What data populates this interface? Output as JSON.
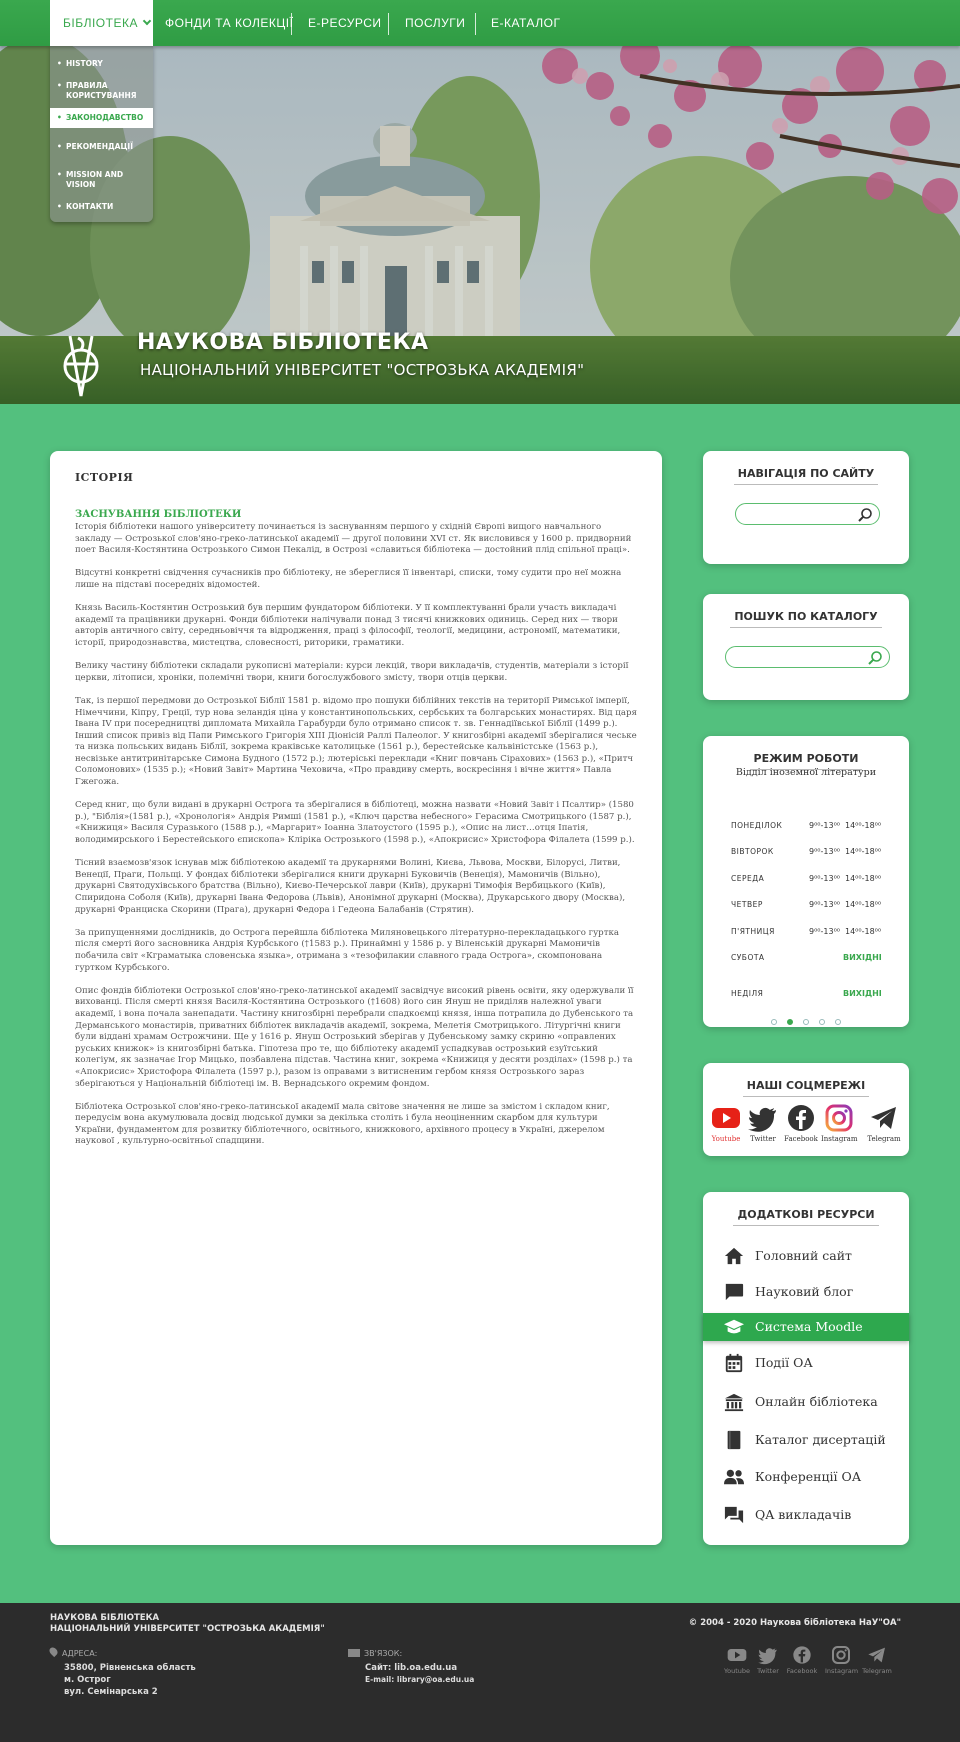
{
  "nav": {
    "items": [
      "Бібліотека",
      "Фонди та колекції",
      "Е-ресурси",
      "Послуги",
      "Е-каталог"
    ],
    "dropdown": [
      "History",
      "Правила користування",
      "Законодавство",
      "Рекомендації",
      "Mission and vision",
      "Контакти"
    ]
  },
  "hero": {
    "title": "НАУКОВА БІБЛІОТЕКА",
    "subtitle": "НАЦІОНАЛЬНИЙ УНІВЕРСИТЕТ \"ОСТРОЗЬКА АКАДЕМІЯ\""
  },
  "article": {
    "title": "ІСТОРІЯ",
    "section": "ЗАСНУВАННЯ БІБЛІОТЕКИ",
    "paragraphs": [
      "Історія бібліотеки нашого університету починається із заснуванням першого у східній Європі вищого навчального закладу — Острозької слов'яно-греко-латинської академії — другої половини XVI ст. Як висловився у 1600 р. придворний поет Василя-Костянтина Острозького Симон Пекалід, в Острозі «славиться бібліотека — достойний плід спільної праці».",
      "Відсутні конкретні свідчення сучасників про бібліотеку, не збереглися її інвентарі, списки, тому судити про неї можна лише на підставі посередніх відомостей.",
      "Князь Василь-Костянтин Острозький був першим фундатором бібліотеки. У її комплектуванні брали участь викладачі академії та працівники друкарні. Фонди бібліотеки налічували понад 3 тисячі книжкових одиниць. Серед них — твори авторів античного світу, середньовіччя та відродження, праці з філософії, теології, медицини, астрономії, математики, історії, природознавства, мистецтва, словесності, риторики, граматики.",
      "Велику частину бібліотеки складали рукописні матеріали: курси лекцій, твори викладачів, студентів, матеріали з історії церкви, літописи, хроніки, полемічні твори, книги богослужбового змісту, твори отців церкви.",
      "Так, із першої передмови до Острозької Біблії 1581 р. відомо про пошуки біблійних текстів на території Римської імперії, Німеччини, Кіпру, Греції, тур нова зеландія ціна у константинопольських, сербських та болгарських монастирях. Від царя Івана IV при посередництві дипломата Михайла Гарабурди було отримано список т. зв. Геннадіївської Біблії (1499 р.). Інший список привіз від Папи Римського Григорія XIII Діонісій Раллі Палеолог. У книгозбірні академії зберігалися чеське та низка польських видань Біблії, зокрема краківське католицьке (1561 р.), берестейське кальвіністське (1563 р.), несвізьке антитринітарське Симона Будного (1572 р.); лютеріські переклади «Книг повчань Сіраховиx» (1563 р.), «Притч Соломонових» (1535 р.); «Новий Завіт» Мартина Чеховича, «Про правдиву смерть, воскресіння і вічне життя» Павла Гжегожа.",
      "Серед книг, що були видані в друкарні Острога та зберігалися в бібліотеці, можна назвати «Новий Завіт і Псалтир» (1580 р.), \"Біблія»(1581 р.), «Хронологія» Андрія Римші (1581 р.), «Ключ царства небесного» Герасима Смотрицького (1587 р.), «Книжиця» Василя Суразького (1588 р.), «Маргарит» Іоанна Златоустого (1595 р.), «Опис на лист…отця Іпатія, володимирського і Берестейського єпископа» Кліріка Острозького (1598 р.), «Апокрисис» Христофора Філалета (1599 р.).",
      "Тісний взаємозв'язок існував між бібліотекою академії та друкарнями Волині, Києва, Львова, Москви, Білорусі, Литви, Венеції, Праги, Польщі. У фондах бібліотеки зберігалися книги друкарні Буковичів (Венеція), Мамоничів (Вільно), друкарні Святодухівського братства (Вільно), Києво-Печерської лаври (Київ), друкарні Тимофія Вербицького (Київ), Спиридона Соболя (Київ), друкарні Івана Федорова (Львів), Анонімної друкарні (Москва), Друкарського двору (Москва), друкарні Франциска Скорини (Прага), друкарні Федора і Гедеона Балабанів (Стрятин).",
      "За припущеннями дослідників, до Острога перейшла бібліотека Миляновецького літературно-перекладацького гуртка після смерті його засновника Андрія Курбського (†1583 р.). Принаймні у 1586 р. у Віленській друкарні Мамоничів побачила світ «Кграматыка словенська языка», отримана з «тезофилакии славного града Острога», скомпонована гуртком Курбського.",
      "Опис фондів бібліотеки Острозької слов'яно-греко-латинської академії засвідчує високий рівень освіти, яку одержували її вихованці. Після смерті князя Василя-Костянтина Острозького (†1608) його син Януш не приділяв належної уваги академії, і вона почала занепадати. Частину книгозбірні перебрали спадкоємці князя, інша потрапила до Дубенського та Дерманського монастирів, приватних бібліотек викладачів академії, зокрема, Мелетія Смотрицького. Літургічні книги були віддані храмам Острожчини. Ще у 1616 р. Януш Острозький зберігав у Дубенському замку скриню «оправлених руських книжок» із книгозбірні батька. Гіпотеза про те, що бібліотеку академії успадкував острозький єзуїтський колегіум, як зазначає Ігор Мицько, позбавлена підстав. Частина книг, зокрема «Книжиця у десяти розділах» (1598 р.) та «Апокрисис» Христофора Філалета (1597 р.), разом із оправами з витисненим гербом князя Острозького зараз зберігаються у Національній бібліотеці ім. В. Вернадського окремим фондом.",
      "Бібліотека Острозької слов'яно-греко-латинської академії мала світове значення не лише за змістом і складом книг, передусім вона акумулювала досвід людської думки за декілька століть і була неоціненним скарбом для культури України, фундаментом для розвитку бібліотечного, освітнього, книжкового, архівного процесу в Україні, джерелом наукової , культурно-освітньої спадщини."
    ]
  },
  "sidebar": {
    "nav_title": "НАВІГАЦІЯ ПО САЙТУ",
    "catalog_title": "ПОШУК ПО КАТАЛОГУ",
    "hours_title": "РЕЖИМ РОБОТИ",
    "hours_dept": "Відділ іноземної літератури",
    "hours": [
      {
        "day": "ПОНЕДІЛОК",
        "t1": "9⁰⁰-13⁰⁰",
        "t2": "14⁰⁰-18⁰⁰"
      },
      {
        "day": "ВІВТОРОК",
        "t1": "9⁰⁰-13⁰⁰",
        "t2": "14⁰⁰-18⁰⁰"
      },
      {
        "day": "СЕРЕДА",
        "t1": "9⁰⁰-13⁰⁰",
        "t2": "14⁰⁰-18⁰⁰"
      },
      {
        "day": "ЧЕТВЕР",
        "t1": "9⁰⁰-13⁰⁰",
        "t2": "14⁰⁰-18⁰⁰"
      },
      {
        "day": "П'ЯТНИЦЯ",
        "t1": "9⁰⁰-13⁰⁰",
        "t2": "14⁰⁰-18⁰⁰"
      }
    ],
    "weekend": [
      {
        "day": "СУБОТА",
        "status": "ВИХІДНІ"
      },
      {
        "day": "НЕДІЛЯ",
        "status": "ВИХІДНІ"
      }
    ],
    "social_title": "НАШІ СОЦМЕРЕЖІ",
    "social": [
      "Youtube",
      "Twitter",
      "Facebook",
      "Instagram",
      "Telegram"
    ],
    "resources_title": "ДОДАТКОВІ РЕСУРСИ",
    "resources": [
      "Головний сайт",
      "Науковий блог",
      "Система Moodle",
      "Події ОА",
      "Онлайн бібліотека",
      "Каталог дисертацій",
      "Конференції ОА",
      "QA викладачів"
    ]
  },
  "footer": {
    "name1": "НАУКОВА БІБЛІОТЕКА",
    "name2": "НАЦІОНАЛЬНИЙ УНІВЕРСИТЕТ \"ОСТРОЗЬКА АКАДЕМІЯ\"",
    "address_label": "АДРЕСА:",
    "address": [
      "35800, Рівненська область",
      "м. Острог",
      "вул. Семінарська 2"
    ],
    "contact_label": "ЗВ'ЯЗОК:",
    "site": "Сайт: lib.oa.edu.ua",
    "email": "E-mail: library@oa.edu.ua",
    "copyright": "© 2004 - 2020 Наукова бібліотека НаУ\"ОА\"",
    "social": [
      "Youtube",
      "Twitter",
      "Facebook",
      "Instagram",
      "Telegram"
    ]
  },
  "colors": {
    "accent": "#3aa84e",
    "background": "#53c07e",
    "footer": "#2c2c2c"
  }
}
